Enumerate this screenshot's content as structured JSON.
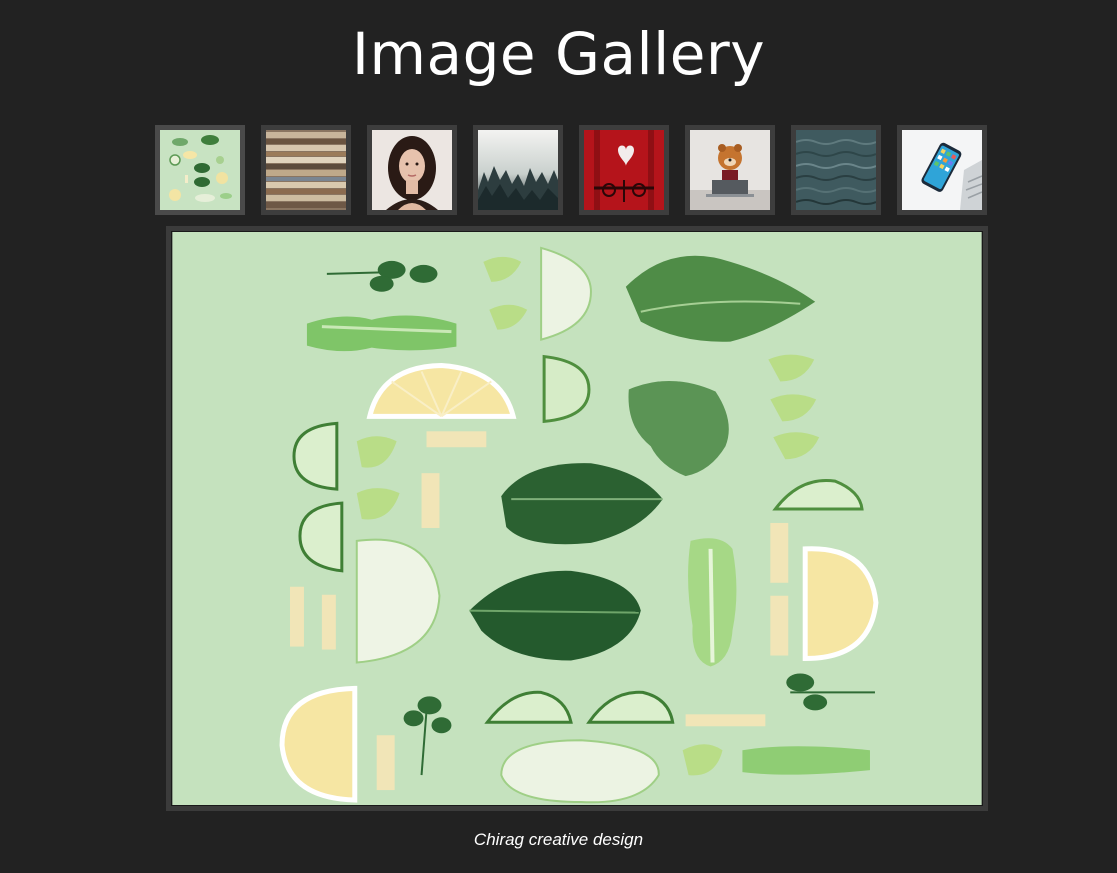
{
  "page": {
    "title": "Image Gallery",
    "caption": "Chirag creative design"
  },
  "gallery": {
    "thumbnails": [
      {
        "subject": "vegetables-image",
        "active": true
      },
      {
        "subject": "books-image",
        "active": false
      },
      {
        "subject": "woman-portrait-image",
        "active": false
      },
      {
        "subject": "misty-forest-image",
        "active": false
      },
      {
        "subject": "red-heart-door-image",
        "active": false
      },
      {
        "subject": "dog-laptop-image",
        "active": false
      },
      {
        "subject": "ocean-water-image",
        "active": false
      },
      {
        "subject": "smartphone-laptop-image",
        "active": false
      }
    ],
    "main_image": "vegetables-image"
  },
  "colors": {
    "background": "#222222",
    "frame": "#3b3b3b",
    "text": "#ffffff",
    "veg_background": "#c5e2be"
  }
}
